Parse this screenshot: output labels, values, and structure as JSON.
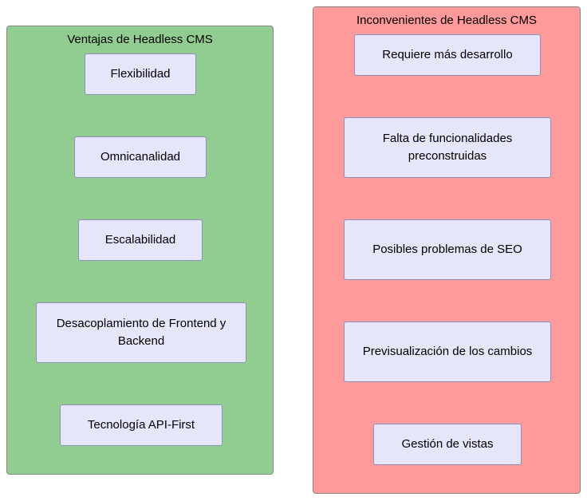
{
  "advantages": {
    "title": "Ventajas de Headless CMS",
    "items": [
      "Flexibilidad",
      "Omnicanalidad",
      "Escalabilidad",
      "Desacoplamiento de Frontend y Backend",
      "Tecnología API-First"
    ]
  },
  "disadvantages": {
    "title": "Inconvenientes de Headless CMS",
    "items": [
      "Requiere más desarrollo",
      "Falta de funcionalidades preconstruidas",
      "Posibles problemas de SEO",
      "Previsualización de los cambios",
      "Gestión de vistas"
    ]
  }
}
